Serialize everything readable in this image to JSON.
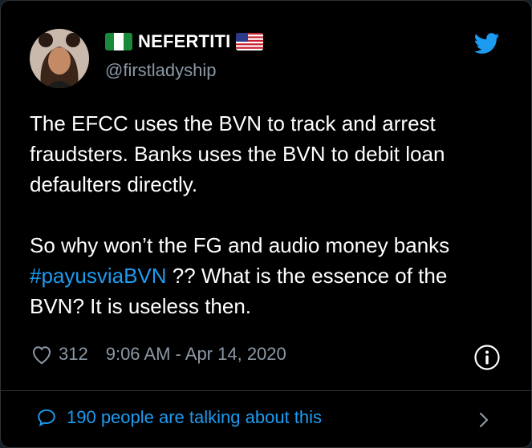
{
  "colors": {
    "background": "#000000",
    "text": "#ffffff",
    "secondary": "#8b98a5",
    "accent": "#1d9bf0",
    "border": "#2f3336"
  },
  "author": {
    "display_name": "NEFERTITI",
    "handle": "@firstladyship",
    "flags": [
      "nigeria-flag-icon",
      "us-flag-icon"
    ]
  },
  "tweet": {
    "paragraph1": "The EFCC uses the BVN to track and arrest fraudsters. Banks uses the BVN to debit loan defaulters directly.",
    "paragraph2_before": "So why won’t the FG and audio money banks ",
    "hashtag": "#payusviaBVN",
    "paragraph2_after": " ?? What is the essence of the BVN? It is useless then."
  },
  "meta": {
    "like_count": "312",
    "timestamp": "9:06 AM - Apr 14, 2020"
  },
  "footer": {
    "talking_text": "190 people are talking about this"
  },
  "icons": {
    "brand": "twitter-bird-icon",
    "like": "heart-icon",
    "info": "info-icon",
    "comment": "speech-bubble-icon",
    "more": "chevron-right-icon"
  }
}
